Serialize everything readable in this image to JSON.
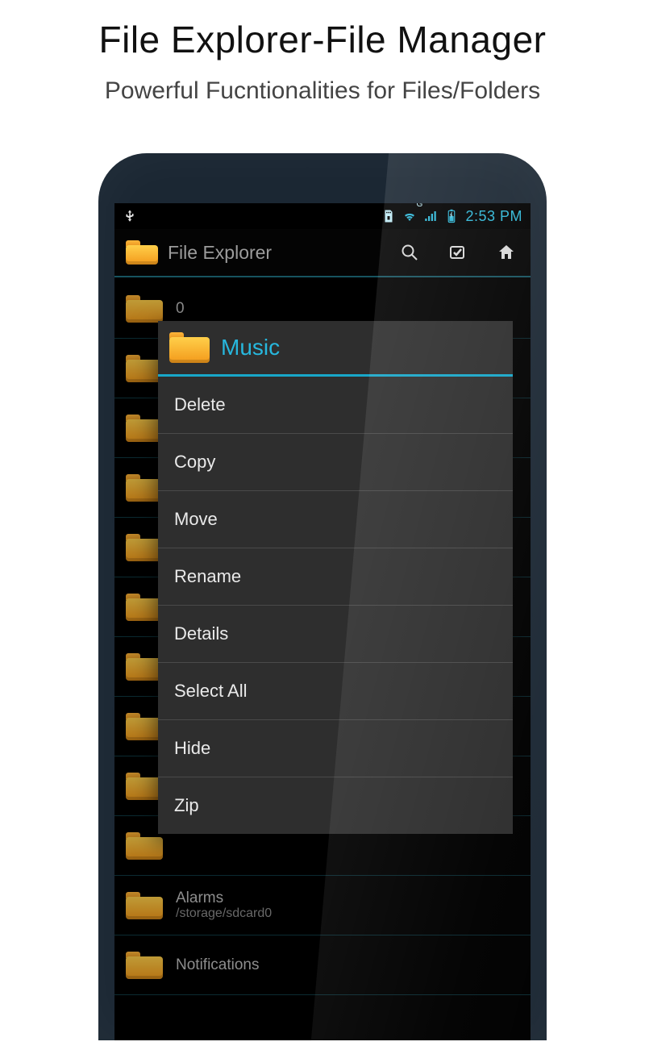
{
  "promo": {
    "title": "File Explorer-File Manager",
    "subtitle": "Powerful Fucntionalities for Files/Folders"
  },
  "statusbar": {
    "time": "2:53 PM",
    "network_label": "G"
  },
  "actionbar": {
    "title": "File Explorer"
  },
  "context_menu": {
    "target": "Music",
    "items": [
      {
        "label": "Delete"
      },
      {
        "label": "Copy"
      },
      {
        "label": "Move"
      },
      {
        "label": "Rename"
      },
      {
        "label": "Details"
      },
      {
        "label": "Select All"
      },
      {
        "label": "Hide"
      },
      {
        "label": "Zip"
      }
    ]
  },
  "background_rows": [
    {
      "name": "0",
      "path": ""
    },
    {
      "name": "",
      "path": ""
    },
    {
      "name": "",
      "path": ""
    },
    {
      "name": "",
      "path": ""
    },
    {
      "name": "",
      "path": ""
    },
    {
      "name": "",
      "path": ""
    },
    {
      "name": "",
      "path": ""
    },
    {
      "name": "",
      "path": ""
    },
    {
      "name": "",
      "path": ""
    },
    {
      "name": "",
      "path": ""
    },
    {
      "name": "Alarms",
      "path": "/storage/sdcard0"
    },
    {
      "name": "Notifications",
      "path": ""
    }
  ],
  "colors": {
    "accent": "#18a7c9",
    "folder_top": "#ffcf4a",
    "folder_bottom": "#f39a1b"
  }
}
